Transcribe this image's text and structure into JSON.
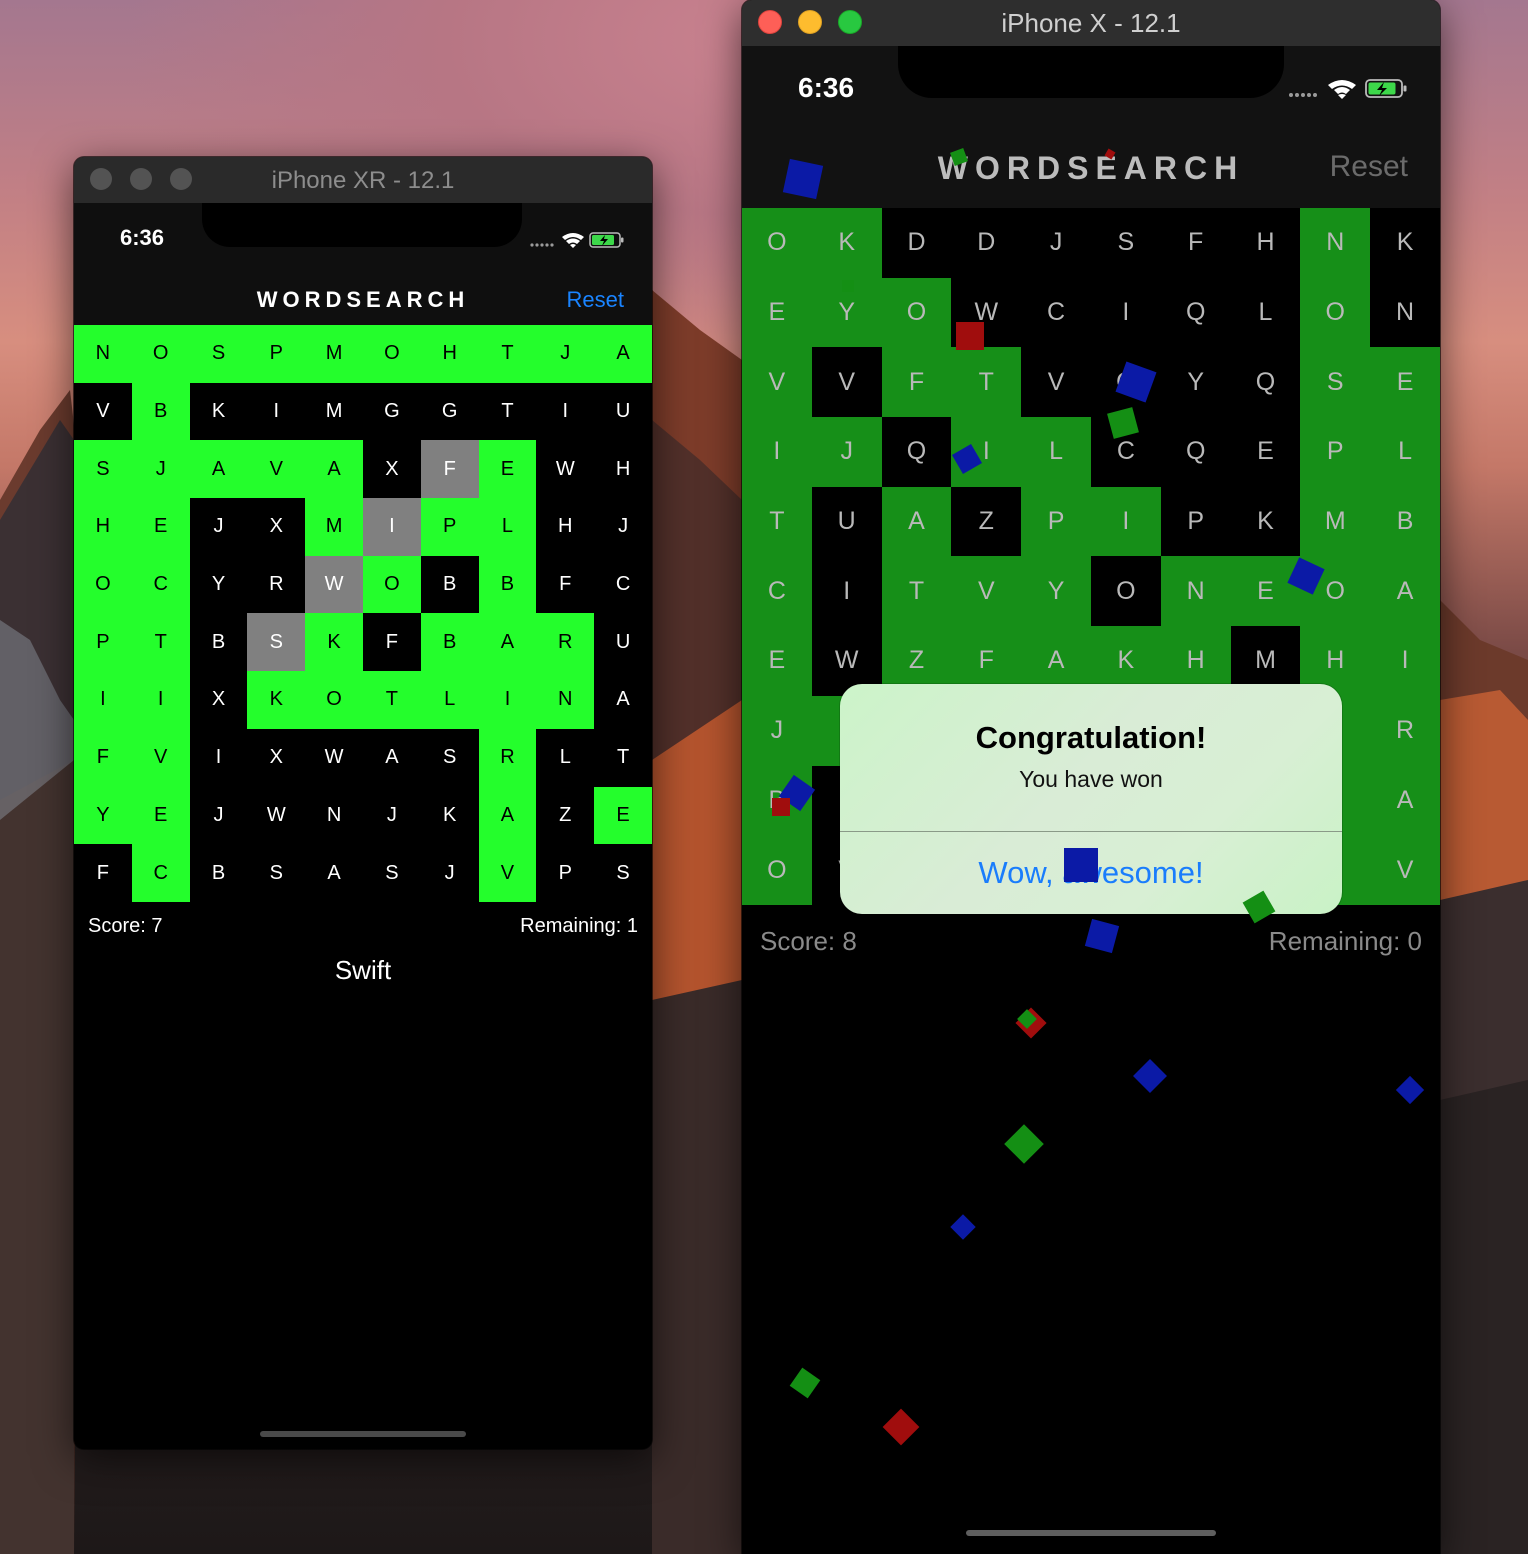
{
  "left_simulator": {
    "window_title": "iPhone XR - 12.1",
    "time": "6:36",
    "nav_title": "WORDSEARCH",
    "reset_label": "Reset",
    "grid": [
      [
        "N",
        "O",
        "S",
        "P",
        "M",
        "O",
        "H",
        "T",
        "J",
        "A"
      ],
      [
        "V",
        "B",
        "K",
        "I",
        "M",
        "G",
        "G",
        "T",
        "I",
        "U"
      ],
      [
        "S",
        "J",
        "A",
        "V",
        "A",
        "X",
        "F",
        "E",
        "W",
        "H"
      ],
      [
        "H",
        "E",
        "J",
        "X",
        "M",
        "I",
        "P",
        "L",
        "H",
        "J"
      ],
      [
        "O",
        "C",
        "Y",
        "R",
        "W",
        "O",
        "B",
        "B",
        "F",
        "C"
      ],
      [
        "P",
        "T",
        "B",
        "S",
        "K",
        "F",
        "B",
        "A",
        "R",
        "U"
      ],
      [
        "I",
        "I",
        "X",
        "K",
        "O",
        "T",
        "L",
        "I",
        "N",
        "A"
      ],
      [
        "F",
        "V",
        "I",
        "X",
        "W",
        "A",
        "S",
        "R",
        "L",
        "T"
      ],
      [
        "Y",
        "E",
        "J",
        "W",
        "N",
        "J",
        "K",
        "A",
        "Z",
        "E"
      ],
      [
        "F",
        "C",
        "B",
        "S",
        "A",
        "S",
        "J",
        "V",
        "P",
        "S"
      ]
    ],
    "cell_states": [
      "gggggggggg",
      "kgkkkkkkkk",
      "gggggksgkk",
      "ggkkgsggkk",
      "ggkksgkgkk",
      "ggksgkgggk",
      "ggkggggggk",
      "ggkkkkkgkk",
      "ggkkkkkgkg",
      "kgkkkkkgkk"
    ],
    "score": "Score: 7",
    "remaining": "Remaining: 1",
    "current_word": "Swift"
  },
  "right_simulator": {
    "window_title": "iPhone X - 12.1",
    "time": "6:36",
    "nav_title": "WORDSEARCH",
    "reset_label": "Reset",
    "grid": [
      [
        "O",
        "K",
        "D",
        "D",
        "J",
        "S",
        "F",
        "H",
        "N",
        "K"
      ],
      [
        "E",
        "Y",
        "O",
        "W",
        "C",
        "I",
        "Q",
        "L",
        "O",
        "N"
      ],
      [
        "V",
        "V",
        "F",
        "T",
        "V",
        "O",
        "Y",
        "Q",
        "S",
        "E"
      ],
      [
        "I",
        "J",
        "Q",
        "I",
        "L",
        "C",
        "Q",
        "E",
        "P",
        "L"
      ],
      [
        "T",
        "U",
        "A",
        "Z",
        "P",
        "I",
        "P",
        "K",
        "M",
        "B"
      ],
      [
        "C",
        "I",
        "T",
        "V",
        "Y",
        "O",
        "N",
        "E",
        "O",
        "A"
      ],
      [
        "E",
        "W",
        "Z",
        "F",
        "A",
        "K",
        "H",
        "M",
        "H",
        "I"
      ],
      [
        "J",
        "I",
        "",
        "",
        "",
        "",
        "",
        "",
        "",
        "R"
      ],
      [
        "B",
        "",
        "",
        "",
        "",
        "",
        "",
        "",
        "",
        "A"
      ],
      [
        "O",
        "V",
        "",
        "",
        "",
        "",
        "",
        "",
        "",
        "V"
      ]
    ],
    "cell_states": [
      "ggkkkkkkgk",
      "gggkkkkkgk",
      "gkggkkkkgg",
      "ggkggkkkgg",
      "gkgkggkkgg",
      "gkgggkggg g",
      "gkgggggkgg",
      "ggkkkkkkgg",
      "gkkkkkkkgg",
      "gkkkkkkkgg"
    ],
    "score": "Score: 8",
    "remaining": "Remaining: 0",
    "alert": {
      "title": "Congratulation!",
      "message": "You have won",
      "button": "Wow, awesome!"
    }
  },
  "colors": {
    "found_bright": "#24fe2c",
    "found_dark": "#168f18",
    "selected": "#808080",
    "link_blue": "#1a84ff",
    "confetti": [
      "#0b1aa6",
      "#148f14",
      "#a00d0d"
    ]
  }
}
